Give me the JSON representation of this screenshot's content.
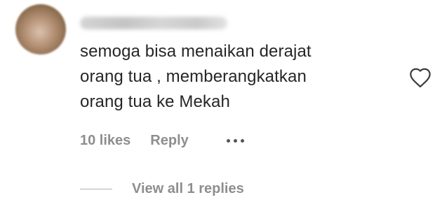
{
  "comment": {
    "text_lines": [
      "semoga bisa menaikan derajat",
      "orang tua , memberangkatkan",
      "orang tua ke Mekah"
    ],
    "likes": "10 likes",
    "reply_label": "Reply",
    "more_icon": "more-horizontal-icon",
    "like_icon": "heart-outline-icon"
  },
  "replies": {
    "view_label": "View all 1 replies"
  },
  "colors": {
    "text": "#262626",
    "meta": "#8e8e8e"
  }
}
